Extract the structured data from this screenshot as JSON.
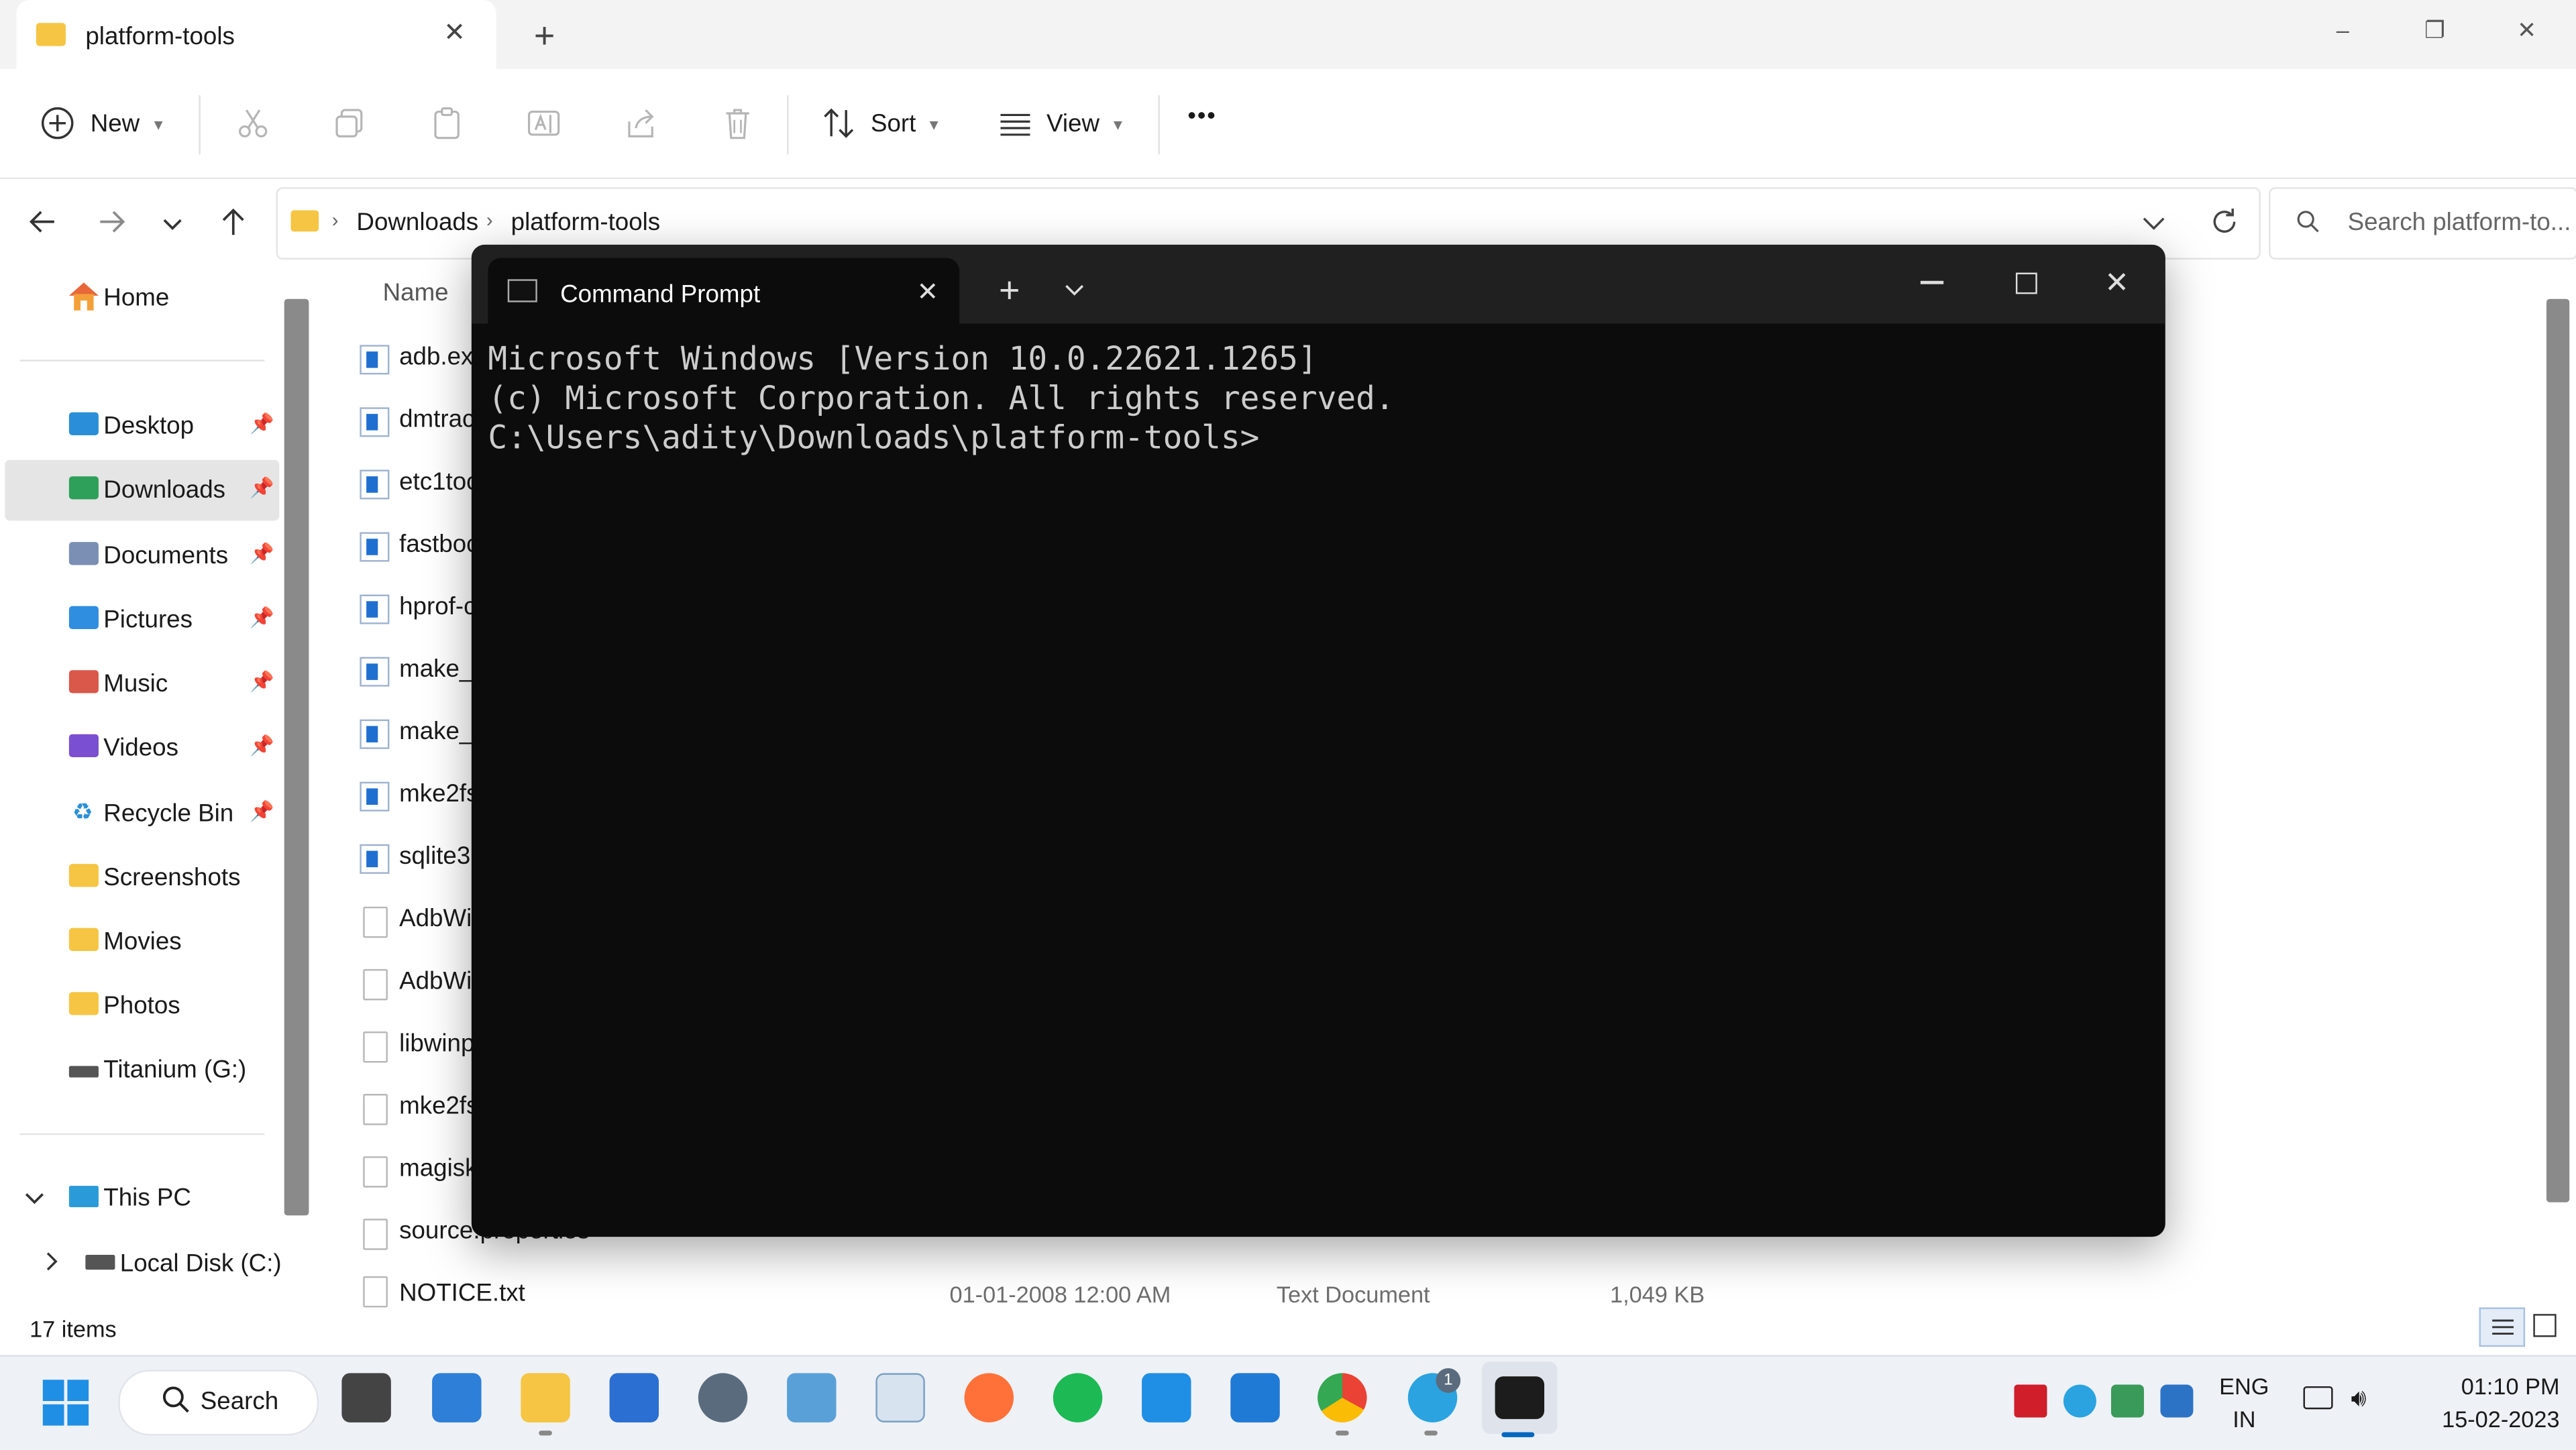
{
  "explorer": {
    "tab_title": "platform-tools",
    "new_tab": "+",
    "window_controls": {
      "minimize": "–",
      "restore": "❐",
      "close": "✕"
    },
    "toolbar": {
      "new_label": "New",
      "sort_label": "Sort",
      "view_label": "View",
      "more": "•••"
    },
    "breadcrumb": [
      "Downloads",
      "platform-tools"
    ],
    "search_placeholder": "Search platform-to...",
    "sidebar": {
      "home": "Home",
      "quick": [
        {
          "label": "Desktop",
          "icon": "desktop-icon"
        },
        {
          "label": "Downloads",
          "icon": "downloads-icon"
        },
        {
          "label": "Documents",
          "icon": "documents-icon"
        },
        {
          "label": "Pictures",
          "icon": "pictures-icon"
        },
        {
          "label": "Music",
          "icon": "music-icon"
        },
        {
          "label": "Videos",
          "icon": "videos-icon"
        },
        {
          "label": "Recycle Bin",
          "icon": "recycle-bin-icon"
        },
        {
          "label": "Screenshots",
          "icon": "folder-icon"
        },
        {
          "label": "Movies",
          "icon": "folder-icon"
        },
        {
          "label": "Photos",
          "icon": "folder-icon"
        },
        {
          "label": "Titanium (G:)",
          "icon": "drive-icon"
        }
      ],
      "this_pc": "This PC",
      "local_disk": "Local Disk (C:)"
    },
    "column_name": "Name",
    "files": [
      {
        "name": "adb.ex",
        "type": "exe"
      },
      {
        "name": "dmtrac",
        "type": "exe"
      },
      {
        "name": "etc1toc",
        "type": "exe"
      },
      {
        "name": "fastboc",
        "type": "exe"
      },
      {
        "name": "hprof-c",
        "type": "exe"
      },
      {
        "name": "make_f",
        "type": "exe"
      },
      {
        "name": "make_f",
        "type": "exe"
      },
      {
        "name": "mke2fs",
        "type": "exe"
      },
      {
        "name": "sqlite3",
        "type": "exe"
      },
      {
        "name": "AdbWi",
        "type": "dll"
      },
      {
        "name": "AdbWi",
        "type": "dll"
      },
      {
        "name": "libwinp",
        "type": "dll"
      },
      {
        "name": "mke2fs",
        "type": "doc"
      },
      {
        "name": "magisk",
        "type": "img"
      },
      {
        "name": "source.properties",
        "type": "doc"
      }
    ],
    "notice_row": {
      "name": "NOTICE.txt",
      "date": "01-01-2008 12:00 AM",
      "type": "Text Document",
      "size": "1,049 KB"
    },
    "status": "17 items"
  },
  "terminal": {
    "tab_title": "Command Prompt",
    "new_tab": "+",
    "lines": [
      "Microsoft Windows [Version 10.0.22621.1265]",
      "(c) Microsoft Corporation. All rights reserved.",
      "",
      "C:\\Users\\adity\\Downloads\\platform-tools>"
    ]
  },
  "taskbar": {
    "search_label": "Search",
    "telegram_badge": "1",
    "lang_top": "ENG",
    "lang_bottom": "IN",
    "time": "01:10 PM",
    "date": "15-02-2023"
  },
  "colors": {
    "accent": "#0067c0",
    "terminal_bg": "#0c0c0c",
    "terminal_text": "#cccccc"
  }
}
